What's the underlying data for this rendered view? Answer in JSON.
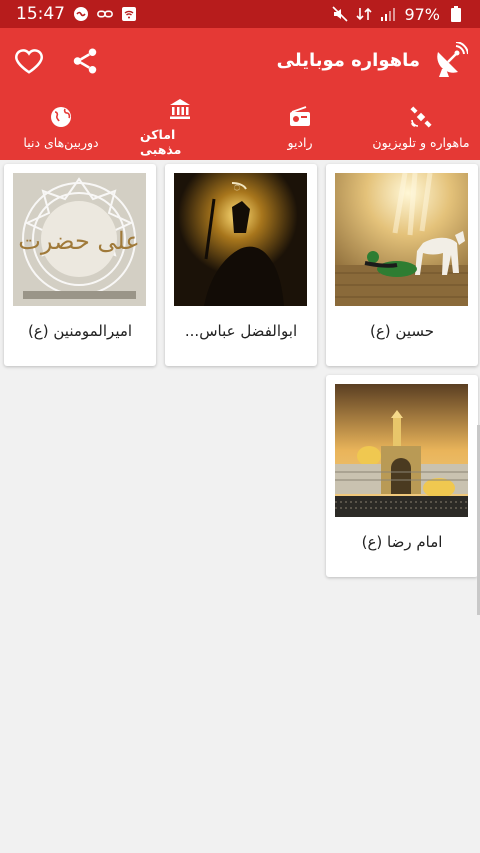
{
  "status_bar": {
    "time": "15:47",
    "battery": "97%",
    "icons": [
      "mute-icon",
      "data-icon",
      "signal-icon",
      "battery-icon",
      "infinity-icon",
      "link-icon",
      "wifi-box-icon"
    ]
  },
  "app_bar": {
    "title": "ماهواره موبایلی",
    "logo_icon": "satellite-dish-icon",
    "actions": [
      "share-icon",
      "heart-icon"
    ]
  },
  "tabs": [
    {
      "label": "ماهواره و تلویزیون",
      "icon": "satellite-icon",
      "active": false
    },
    {
      "label": "رادیو",
      "icon": "radio-icon",
      "active": false
    },
    {
      "label": "اماکن مذهبی",
      "icon": "bank-icon",
      "active": true
    },
    {
      "label": "دوربین‌های دنیا",
      "icon": "globe-icon",
      "active": false
    }
  ],
  "cards": [
    {
      "title": "حسین (ع)"
    },
    {
      "title": "ابوالفضل عباس..."
    },
    {
      "title": "امیرالمومنین (ع)",
      "thumb_text": "علی حضرت"
    },
    {
      "title": "امام رضا (ع)"
    }
  ],
  "colors": {
    "status_bar": "#b71c1c",
    "app_bar": "#e53935",
    "background": "#f1f1f1",
    "card": "#ffffff"
  }
}
